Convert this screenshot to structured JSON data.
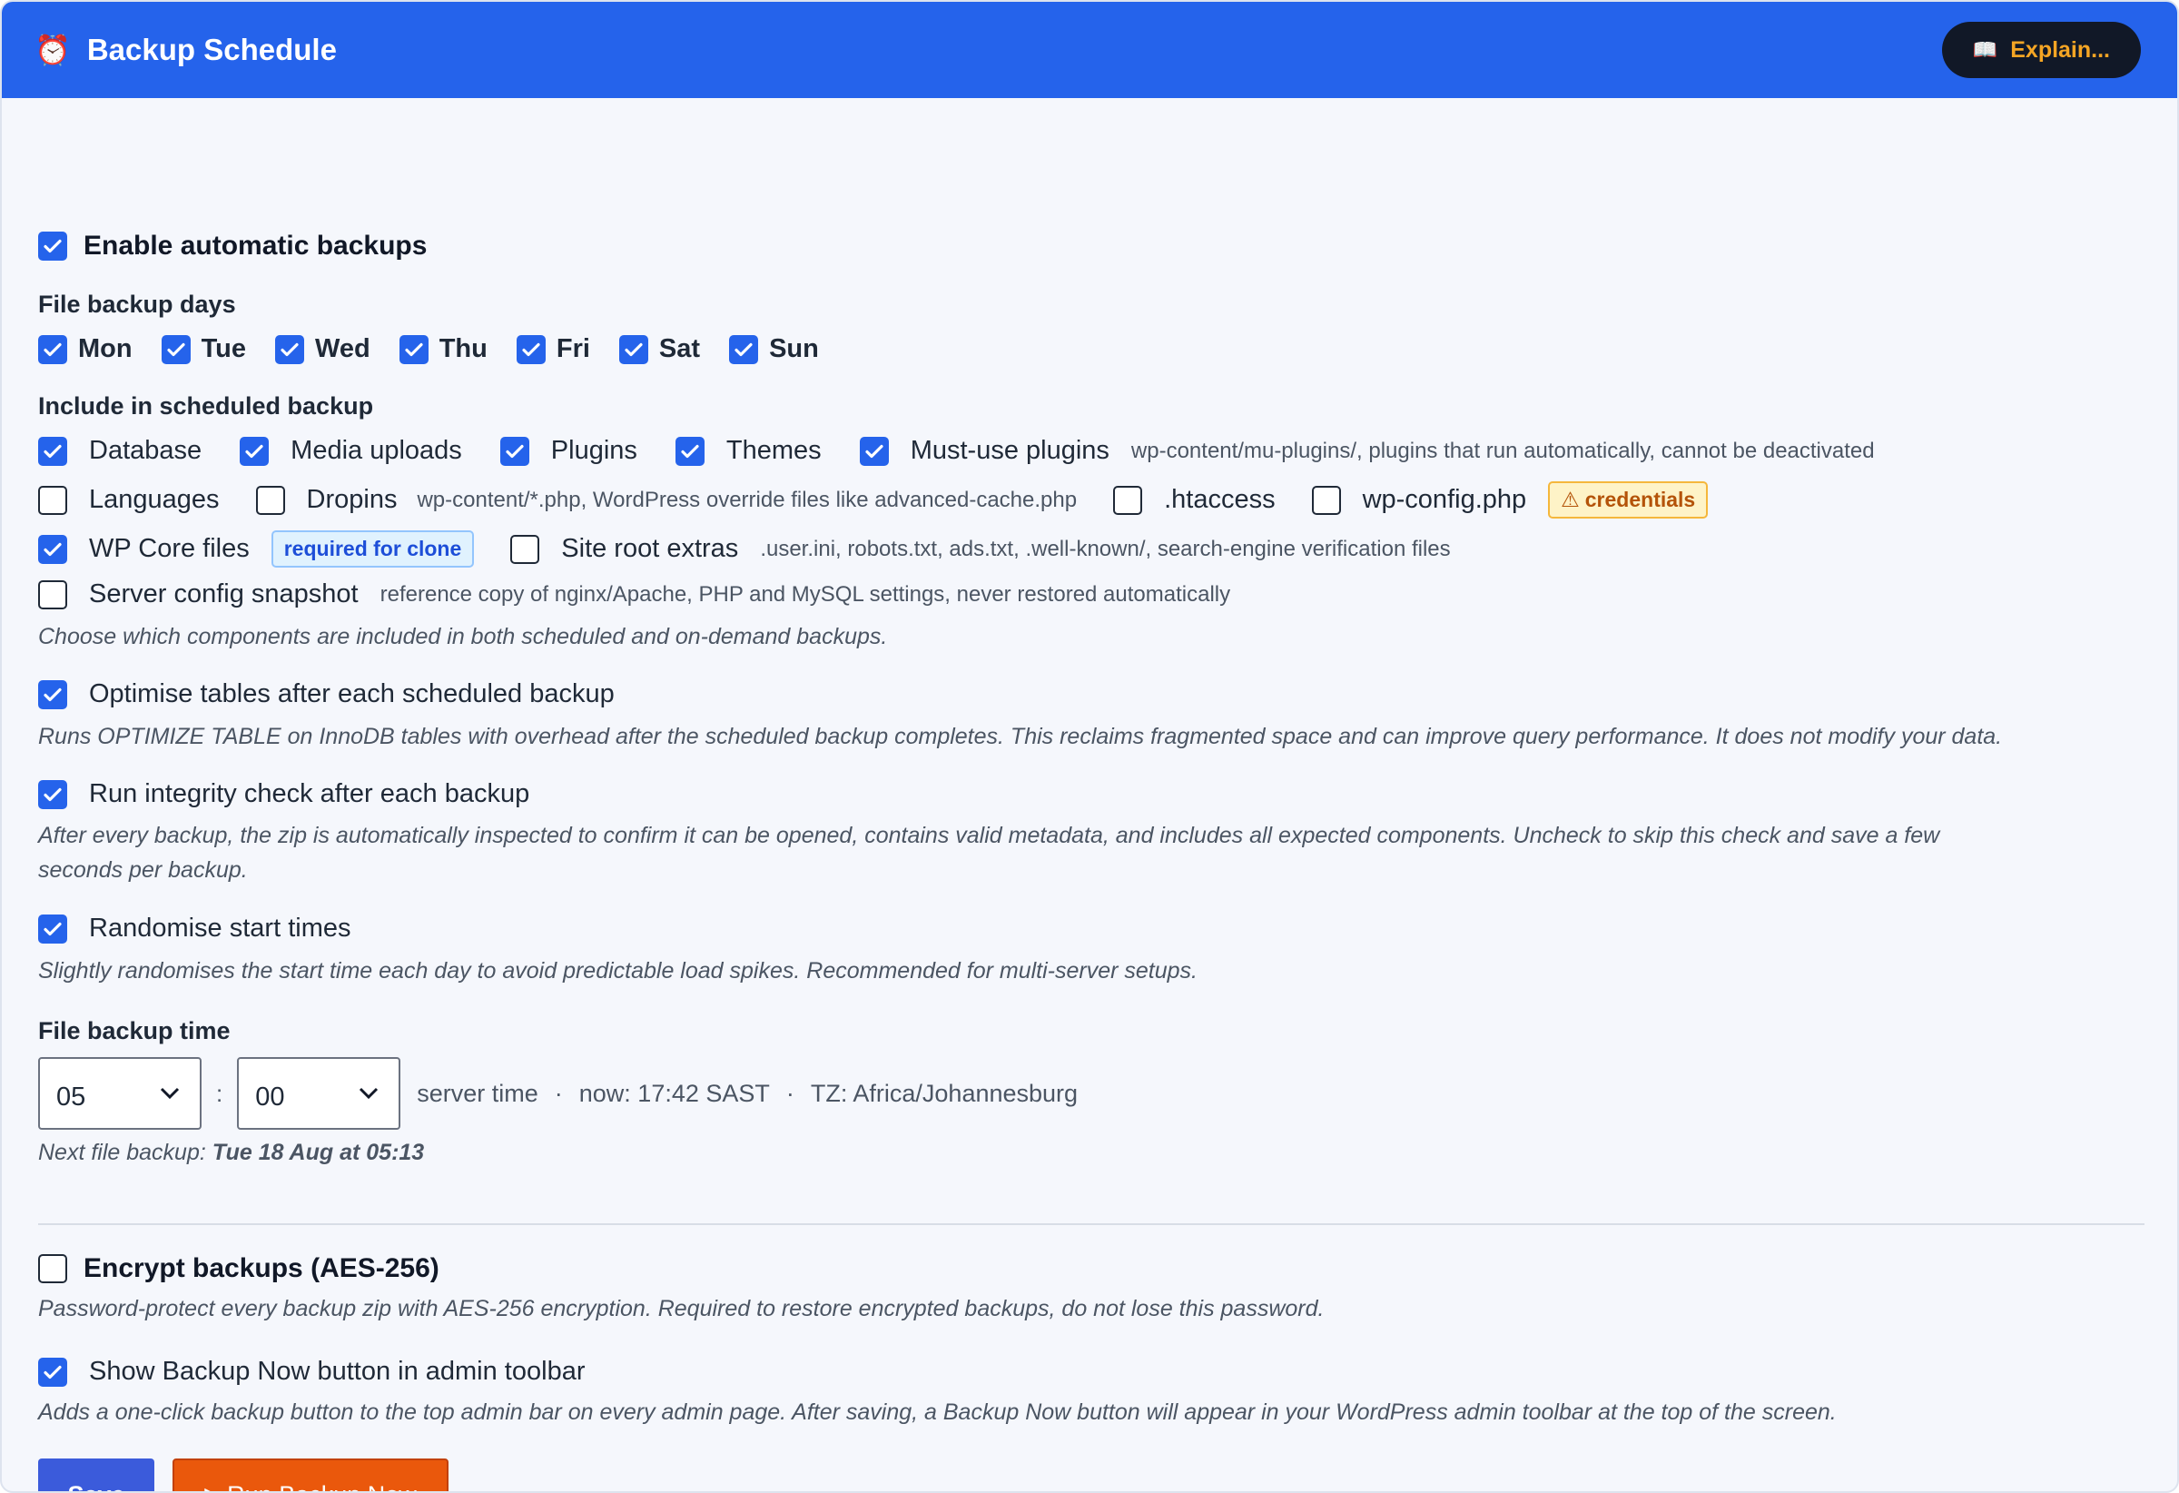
{
  "header": {
    "title": "Backup Schedule",
    "explain_label": "Explain..."
  },
  "enable": {
    "label": "Enable automatic backups",
    "checked": true
  },
  "days": {
    "label": "File backup days",
    "items": [
      {
        "label": "Mon",
        "checked": true
      },
      {
        "label": "Tue",
        "checked": true
      },
      {
        "label": "Wed",
        "checked": true
      },
      {
        "label": "Thu",
        "checked": true
      },
      {
        "label": "Fri",
        "checked": true
      },
      {
        "label": "Sat",
        "checked": true
      },
      {
        "label": "Sun",
        "checked": true
      }
    ]
  },
  "include": {
    "label": "Include in scheduled backup",
    "database": {
      "label": "Database",
      "checked": true
    },
    "media": {
      "label": "Media uploads",
      "checked": true
    },
    "plugins": {
      "label": "Plugins",
      "checked": true
    },
    "themes": {
      "label": "Themes",
      "checked": true
    },
    "mu_plugins": {
      "label": "Must-use plugins",
      "checked": true,
      "hint": "wp-content/mu-plugins/, plugins that run automatically, cannot be deactivated"
    },
    "languages": {
      "label": "Languages",
      "checked": false
    },
    "dropins": {
      "label": "Dropins",
      "checked": false,
      "hint": "wp-content/*.php, WordPress override files like advanced-cache.php"
    },
    "htaccess": {
      "label": ".htaccess",
      "checked": false
    },
    "wpconfig": {
      "label": "wp-config.php",
      "checked": false,
      "badge": "credentials"
    },
    "core": {
      "label": "WP Core files",
      "checked": true,
      "badge": "required for clone"
    },
    "site_root": {
      "label": "Site root extras",
      "checked": false,
      "hint": ".user.ini, robots.txt, ads.txt, .well-known/, search-engine verification files"
    },
    "server_config": {
      "label": "Server config snapshot",
      "checked": false,
      "hint": "reference copy of nginx/Apache, PHP and MySQL settings, never restored automatically"
    },
    "help": "Choose which components are included in both scheduled and on-demand backups."
  },
  "optimise": {
    "label": "Optimise tables after each scheduled backup",
    "checked": true,
    "help": "Runs OPTIMIZE TABLE on InnoDB tables with overhead after the scheduled backup completes. This reclaims fragmented space and can improve query performance. It does not modify your data."
  },
  "integrity": {
    "label": "Run integrity check after each backup",
    "checked": true,
    "help_line1": "After every backup, the zip is automatically inspected to confirm it can be opened, contains valid metadata, and includes all expected components. Uncheck to skip this check and save a few",
    "help_line2": "seconds per backup."
  },
  "randomise": {
    "label": "Randomise start times",
    "checked": true,
    "help": "Slightly randomises the start time each day to avoid predictable load spikes. Recommended for multi-server setups."
  },
  "time": {
    "label": "File backup time",
    "hour": "05",
    "separator": ":",
    "minute": "00",
    "server_time": "server time",
    "dot": "·",
    "now": "now: 17:42 SAST",
    "tz": "TZ: Africa/Johannesburg",
    "next_prefix": "Next file backup:",
    "next_value": "Tue 18 Aug at 05:13"
  },
  "encrypt": {
    "label": "Encrypt backups (AES-256)",
    "checked": false,
    "help": "Password-protect every backup zip with AES-256 encryption. Required to restore encrypted backups, do not lose this password."
  },
  "toolbar": {
    "label": "Show Backup Now button in admin toolbar",
    "checked": true,
    "help": "Adds a one-click backup button to the top admin bar on every admin page. After saving, a Backup Now button will appear in your WordPress admin toolbar at the top of the screen."
  },
  "actions": {
    "save_label": "Save",
    "run_label": "Run Backup Now"
  },
  "colors": {
    "header": "#2563eb",
    "accent": "#2563eb",
    "save": "#3b5bdb",
    "run": "#ea580c",
    "explain_bg": "#111827",
    "explain_text": "#f5a524"
  }
}
